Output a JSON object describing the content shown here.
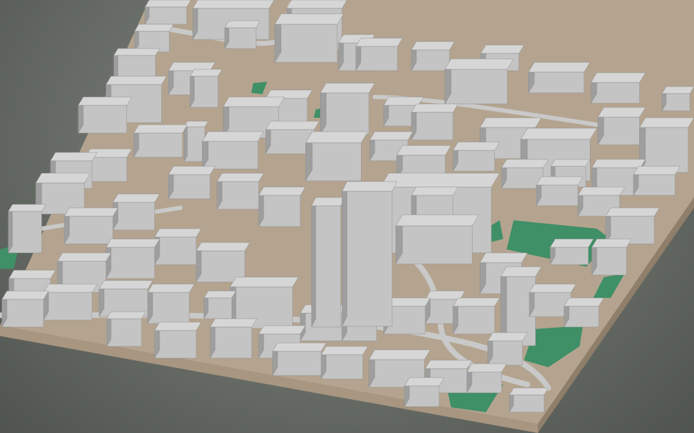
{
  "scene": {
    "subject": "3d-city-model",
    "colors": {
      "background_center": "#8a8f88",
      "background_edge": "#4f5450",
      "ground": "#b4a48f",
      "base_front": "#a89680",
      "base_side": "#8f7e69",
      "building_roof": "#d6d6d6",
      "building_wall_light": "#c4c4c4",
      "building_wall_dark": "#9e9e9e",
      "road": "#c9c9c9",
      "park": "#3f8f67"
    }
  }
}
